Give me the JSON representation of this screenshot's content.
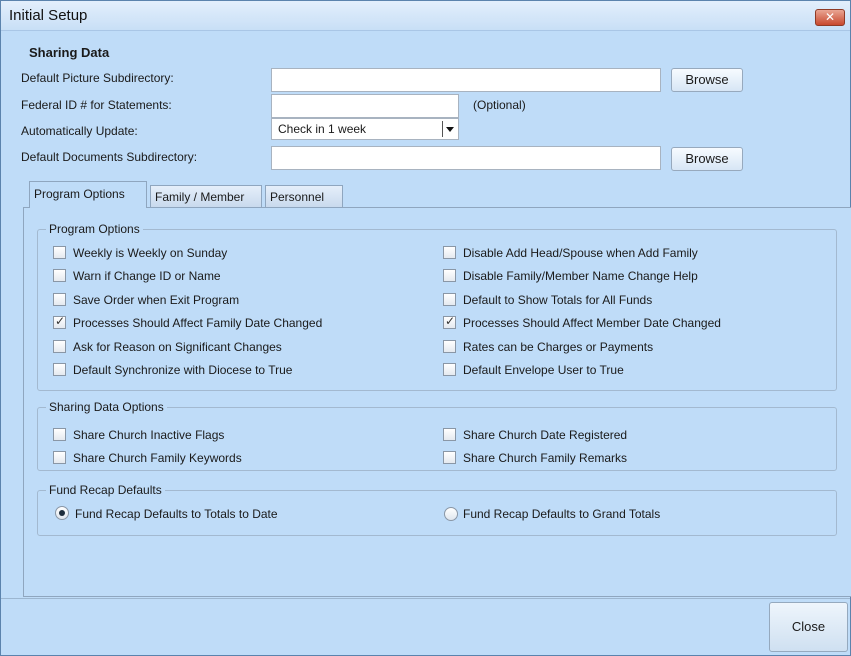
{
  "window": {
    "title": "Initial Setup",
    "close_glyph": "✕",
    "close_button": "Close"
  },
  "sharing_data": {
    "title": "Sharing Data",
    "picture_dir_label": "Default Picture Subdirectory:",
    "picture_dir_value": "",
    "federal_id_label": "Federal ID # for Statements:",
    "federal_id_value": "",
    "optional_note": "(Optional)",
    "auto_update_label": "Automatically Update:",
    "auto_update_value": "Check in 1 week",
    "documents_dir_label": "Default Documents Subdirectory:",
    "documents_dir_value": "",
    "browse_label": "Browse"
  },
  "tabs": [
    {
      "label": "Program Options",
      "active": true
    },
    {
      "label": "Family / Member",
      "active": false
    },
    {
      "label": "Personnel",
      "active": false
    }
  ],
  "program_options": {
    "title": "Program Options",
    "left": [
      {
        "label": "Weekly is Weekly on Sunday",
        "checked": false
      },
      {
        "label": "Warn if Change ID or Name",
        "checked": false
      },
      {
        "label": "Save Order when Exit Program",
        "checked": false
      },
      {
        "label": "Processes Should Affect Family Date Changed",
        "checked": true
      },
      {
        "label": "Ask for Reason on Significant Changes",
        "checked": false
      },
      {
        "label": "Default Synchronize with Diocese to True",
        "checked": false
      }
    ],
    "right": [
      {
        "label": "Disable Add Head/Spouse when Add Family",
        "checked": false
      },
      {
        "label": "Disable Family/Member Name Change Help",
        "checked": false
      },
      {
        "label": "Default to Show Totals for All Funds",
        "checked": false
      },
      {
        "label": "Processes Should Affect Member Date Changed",
        "checked": true
      },
      {
        "label": "Rates can be Charges or Payments",
        "checked": false
      },
      {
        "label": "Default Envelope User to True",
        "checked": false
      }
    ]
  },
  "sharing_options": {
    "title": "Sharing Data Options",
    "items": [
      {
        "label": "Share Church Inactive Flags",
        "checked": false
      },
      {
        "label": "Share Church Date Registered",
        "checked": false
      },
      {
        "label": "Share Church Family Keywords",
        "checked": false
      },
      {
        "label": "Share Church Family Remarks",
        "checked": false
      }
    ]
  },
  "fund_recap": {
    "title": "Fund Recap Defaults",
    "options": [
      {
        "label": "Fund Recap Defaults to Totals to Date",
        "selected": true
      },
      {
        "label": "Fund Recap Defaults to Grand Totals",
        "selected": false
      }
    ]
  }
}
